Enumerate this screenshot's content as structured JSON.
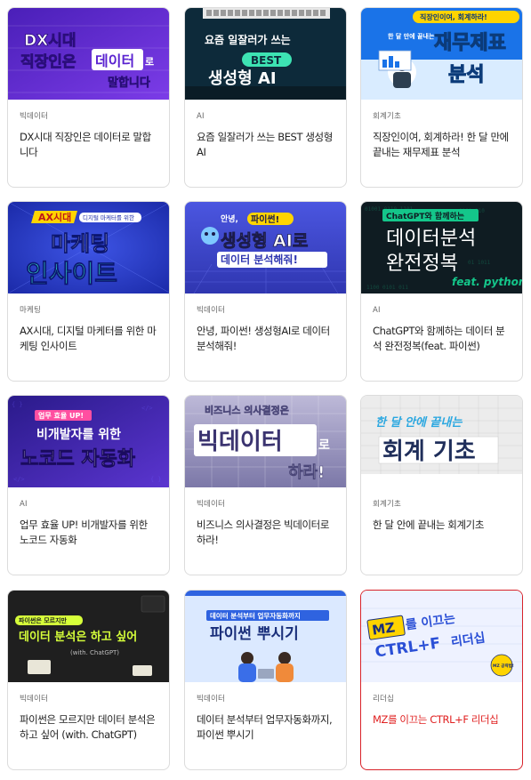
{
  "courses": [
    {
      "category": "빅데이터",
      "title": "DX시대 직장인은 데이터로 말합니다",
      "thumb_text": [
        "DX시대",
        "직장인은",
        "데이터",
        "로",
        "말합니다"
      ],
      "accent": "#6a2fd6"
    },
    {
      "category": "AI",
      "title": "요즘 일잘러가 쓰는 BEST 생성형 AI",
      "thumb_text": [
        "요즘 일잘러가 쓰는",
        "BEST",
        "생성형 AI"
      ],
      "accent": "#0d2a3a"
    },
    {
      "category": "회계기초",
      "title": "직장인이여, 회계하라! 한 달 만에 끝내는 재무제표 분석",
      "thumb_text": [
        "직장인이여, 회계하라!",
        "한 달 만에 끝내는",
        "재무제표",
        "분석"
      ],
      "accent": "#1a73e8"
    },
    {
      "category": "마케팅",
      "title": "AX시대, 디지털 마케터를 위한 마케팅 인사이트",
      "thumb_text": [
        "AX시대",
        "디지털 마케터를 위한",
        "마케팅",
        "인사이트"
      ],
      "accent": "#2b3ec9"
    },
    {
      "category": "빅데이터",
      "title": "안녕, 파이썬! 생성형AI로 데이터 분석해줘!",
      "thumb_text": [
        "안녕,",
        "파이썬!",
        "생성형 AI로",
        "데이터 분석해줘!"
      ],
      "accent": "#3b46c8"
    },
    {
      "category": "AI",
      "title": "ChatGPT와 함께하는 데이터 분석 완전정복(feat. 파이썬)",
      "thumb_text": [
        "ChatGPT와 함께하는",
        "데이터분석",
        "완전정복",
        "feat. python"
      ],
      "accent": "#0f1c22"
    },
    {
      "category": "AI",
      "title": "업무 효율 UP! 비개발자를 위한 노코드 자동화",
      "thumb_text": [
        "업무 효율 UP!",
        "비개발자를 위한",
        "노코드 자동화"
      ],
      "accent": "#4a2cbf"
    },
    {
      "category": "빅데이터",
      "title": "비즈니스 의사결정은 빅데이터로 하라!",
      "thumb_text": [
        "비즈니스 의사결정은",
        "빅데이터",
        "로",
        "하라!"
      ],
      "accent": "#8a86b6"
    },
    {
      "category": "회계기초",
      "title": "한 달 안에 끝내는 회계기초",
      "thumb_text": [
        "한 달 안에 끝내는",
        "회계 기초"
      ],
      "accent": "#e9e9e9"
    },
    {
      "category": "빅데이터",
      "title": "파이썬은 모르지만 데이터 분석은 하고 싶어 (with. ChatGPT)",
      "thumb_text": [
        "파이썬은 모르지만",
        "데이터 분석은 하고 싶어",
        "(with. ChatGPT)"
      ],
      "accent": "#1f1f1f"
    },
    {
      "category": "빅데이터",
      "title": "데이터 분석부터 업무자동화까지, 파이썬 뿌시기",
      "thumb_text": [
        "데이터 분석부터 업무자동화까지",
        "파이썬 뿌시기"
      ],
      "accent": "#dbe9ff"
    },
    {
      "category": "리더십",
      "title": "MZ를 이끄는 CTRL+F 리더십",
      "thumb_text": [
        "MZ",
        "를 이끄는",
        "CTRL+F",
        "리더십",
        "MZ 공략법!"
      ],
      "accent": "#2a4fd6"
    }
  ]
}
